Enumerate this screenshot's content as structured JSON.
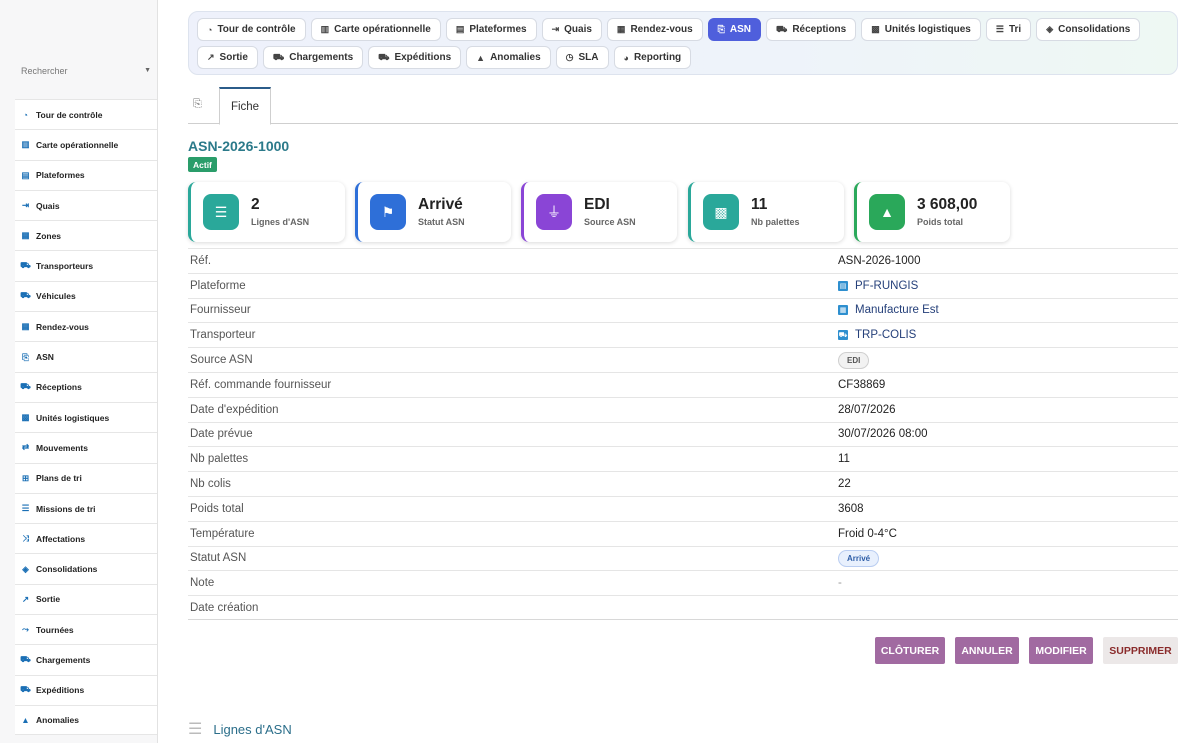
{
  "sidebar": {
    "search_placeholder": "Rechercher",
    "items": [
      {
        "label": "Tour de contrôle",
        "icon": "gauge-icon"
      },
      {
        "label": "Carte opérationnelle",
        "icon": "map-icon"
      },
      {
        "label": "Plateformes",
        "icon": "warehouse-icon"
      },
      {
        "label": "Quais",
        "icon": "dock-icon"
      },
      {
        "label": "Zones",
        "icon": "grid-icon"
      },
      {
        "label": "Transporteurs",
        "icon": "truck-icon"
      },
      {
        "label": "Véhicules",
        "icon": "bus-icon"
      },
      {
        "label": "Rendez-vous",
        "icon": "calendar-icon"
      },
      {
        "label": "ASN",
        "icon": "file-import-icon"
      },
      {
        "label": "Réceptions",
        "icon": "dolly-icon"
      },
      {
        "label": "Unités logistiques",
        "icon": "pallet-icon"
      },
      {
        "label": "Mouvements",
        "icon": "arrows-icon"
      },
      {
        "label": "Plans de tri",
        "icon": "sitemap-icon"
      },
      {
        "label": "Missions de tri",
        "icon": "list-icon"
      },
      {
        "label": "Affectations",
        "icon": "shuffle-icon"
      },
      {
        "label": "Consolidations",
        "icon": "layers-icon"
      },
      {
        "label": "Sortie",
        "icon": "external-link-icon"
      },
      {
        "label": "Tournées",
        "icon": "route-icon"
      },
      {
        "label": "Chargements",
        "icon": "truck-loading-icon"
      },
      {
        "label": "Expéditions",
        "icon": "shipping-icon"
      },
      {
        "label": "Anomalies",
        "icon": "warning-icon"
      }
    ]
  },
  "topnav": {
    "row1": [
      {
        "label": "Tour de contrôle",
        "icon": "gauge-icon",
        "glyph": "◔"
      },
      {
        "label": "Carte opérationnelle",
        "icon": "map-icon",
        "glyph": "▥"
      },
      {
        "label": "Plateformes",
        "icon": "warehouse-icon",
        "glyph": "▤"
      },
      {
        "label": "Quais",
        "icon": "dock-icon",
        "glyph": "⇥"
      },
      {
        "label": "Rendez-vous",
        "icon": "calendar-icon",
        "glyph": "▦"
      },
      {
        "label": "ASN",
        "icon": "file-import-icon",
        "glyph": "⎘",
        "active": true
      },
      {
        "label": "Réceptions",
        "icon": "dolly-icon",
        "glyph": "⛟"
      },
      {
        "label": "Unités logistiques",
        "icon": "pallet-icon",
        "glyph": "▩"
      },
      {
        "label": "Tri",
        "icon": "list-icon",
        "glyph": "☰"
      },
      {
        "label": "Consolidations",
        "icon": "layers-icon",
        "glyph": "◈"
      }
    ],
    "row2": [
      {
        "label": "Sortie",
        "icon": "external-link-icon",
        "glyph": "↗"
      },
      {
        "label": "Chargements",
        "icon": "truck-loading-icon",
        "glyph": "⛟"
      },
      {
        "label": "Expéditions",
        "icon": "shipping-icon",
        "glyph": "⛟"
      },
      {
        "label": "Anomalies",
        "icon": "warning-icon",
        "glyph": "▲"
      },
      {
        "label": "SLA",
        "icon": "stopwatch-icon",
        "glyph": "◷"
      },
      {
        "label": "Reporting",
        "icon": "pie-chart-icon",
        "glyph": "◕"
      }
    ]
  },
  "tabs": {
    "fiche_label": "Fiche"
  },
  "record": {
    "title": "ASN-2026-1000",
    "status_badge": "Actif"
  },
  "cards": [
    {
      "value": "2",
      "label": "Lignes d'ASN",
      "icon": "list-icon",
      "color": "#2aa89a"
    },
    {
      "value": "Arrivé",
      "label": "Statut ASN",
      "icon": "flag-icon",
      "color": "#2e6fd8"
    },
    {
      "value": "EDI",
      "label": "Source ASN",
      "icon": "plug-icon",
      "color": "#8a45d6"
    },
    {
      "value": "11",
      "label": "Nb palettes",
      "icon": "pallet-icon",
      "color": "#2aa89a"
    },
    {
      "value": "3 608,00",
      "label": "Poids total",
      "icon": "weight-icon",
      "color": "#2aa85a"
    }
  ],
  "details": [
    {
      "key": "Réf.",
      "value": "ASN-2026-1000"
    },
    {
      "key": "Plateforme",
      "value": "PF-RUNGIS",
      "type": "link",
      "icon": "warehouse-icon"
    },
    {
      "key": "Fournisseur",
      "value": "Manufacture Est",
      "type": "link",
      "icon": "building-icon"
    },
    {
      "key": "Transporteur",
      "value": "TRP-COLIS",
      "type": "link",
      "icon": "truck-icon"
    },
    {
      "key": "Source ASN",
      "value": "EDI",
      "type": "pill"
    },
    {
      "key": "Réf. commande fournisseur",
      "value": "CF38869"
    },
    {
      "key": "Date d'expédition",
      "value": "28/07/2026"
    },
    {
      "key": "Date prévue",
      "value": "30/07/2026 08:00"
    },
    {
      "key": "Nb palettes",
      "value": "11"
    },
    {
      "key": "Nb colis",
      "value": "22"
    },
    {
      "key": "Poids total",
      "value": "3608"
    },
    {
      "key": "Température",
      "value": "Froid 0-4°C"
    },
    {
      "key": "Statut ASN",
      "value": "Arrivé",
      "type": "pill-blue"
    },
    {
      "key": "Note",
      "value": "-",
      "type": "muted"
    },
    {
      "key": "Date création",
      "value": ""
    }
  ],
  "actions": [
    {
      "label": "CLÔTURER"
    },
    {
      "label": "ANNULER"
    },
    {
      "label": "MODIFIER"
    },
    {
      "label": "SUPPRIMER",
      "style": "light"
    }
  ],
  "section": {
    "lignes_title": "Lignes d'ASN"
  }
}
